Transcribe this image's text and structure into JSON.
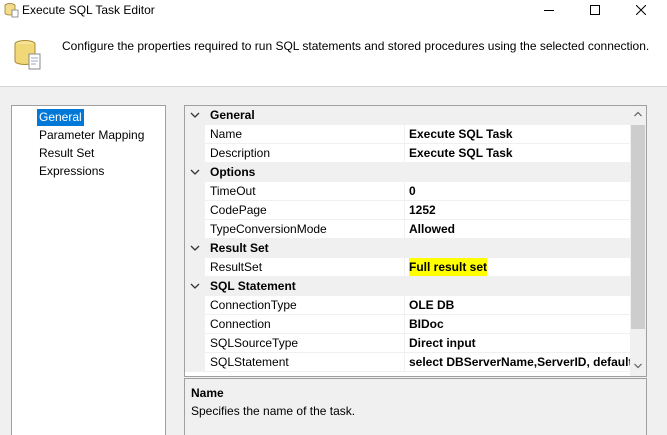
{
  "window": {
    "title": "Execute SQL Task Editor",
    "controls": {
      "minimize": "minimize-icon",
      "maximize": "maximize-icon",
      "close": "close-icon"
    }
  },
  "header": {
    "icon": "task-icon",
    "description": "Configure the properties required to run SQL statements and stored procedures using the selected connection."
  },
  "nav": {
    "items": [
      {
        "label": "General",
        "selected": true
      },
      {
        "label": "Parameter Mapping",
        "selected": false
      },
      {
        "label": "Result Set",
        "selected": false
      },
      {
        "label": "Expressions",
        "selected": false
      }
    ]
  },
  "grid": {
    "categories": [
      {
        "label": "General",
        "properties": [
          {
            "name": "Name",
            "value": "Execute SQL Task"
          },
          {
            "name": "Description",
            "value": "Execute SQL Task"
          }
        ]
      },
      {
        "label": "Options",
        "properties": [
          {
            "name": "TimeOut",
            "value": "0"
          },
          {
            "name": "CodePage",
            "value": "1252"
          },
          {
            "name": "TypeConversionMode",
            "value": "Allowed"
          }
        ]
      },
      {
        "label": "Result Set",
        "properties": [
          {
            "name": "ResultSet",
            "value": "Full result set",
            "highlighted": true
          }
        ]
      },
      {
        "label": "SQL Statement",
        "properties": [
          {
            "name": "ConnectionType",
            "value": "OLE DB"
          },
          {
            "name": "Connection",
            "value": "BIDoc"
          },
          {
            "name": "SQLSourceType",
            "value": "Direct input"
          },
          {
            "name": "SQLStatement",
            "value": "select  DBServerName,ServerID, default"
          }
        ]
      }
    ]
  },
  "description_pane": {
    "title": "Name",
    "text": "Specifies the name of the task."
  },
  "colors": {
    "selection": "#0078d7",
    "highlight": "#ffff00",
    "panel_bg": "#f0f0f0"
  }
}
